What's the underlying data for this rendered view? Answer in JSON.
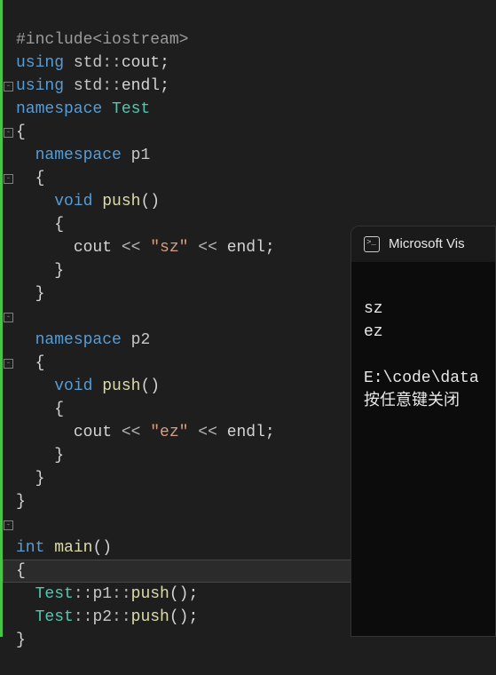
{
  "code": {
    "line1_include": "#include",
    "line1_header": "<iostream>",
    "line2_using": "using",
    "line2_std": "std",
    "line2_cout": "cout",
    "line3_using": "using",
    "line3_std": "std",
    "line3_endl": "endl",
    "line4_namespace": "namespace",
    "line4_Test": "Test",
    "line6_namespace": "namespace",
    "line6_p1": "p1",
    "line8_void": "void",
    "line8_push": "push",
    "line10_cout": "cout",
    "line10_sz": "\"sz\"",
    "line10_endl": "endl",
    "line14_namespace": "namespace",
    "line14_p2": "p2",
    "line16_void": "void",
    "line16_push": "push",
    "line18_cout": "cout",
    "line18_ez": "\"ez\"",
    "line18_endl": "endl",
    "line22_int": "int",
    "line22_main": "main",
    "line24_Test": "Test",
    "line24_p1": "p1",
    "line24_push": "push",
    "line25_Test": "Test",
    "line25_p2": "p2",
    "line25_push": "push",
    "brace_open": "{",
    "brace_close": "}",
    "paren_pair": "()",
    "scope": "::",
    "semi": ";",
    "shift": " << "
  },
  "terminal": {
    "title": "Microsoft Vis",
    "out1": "sz",
    "out2": "ez",
    "path": "E:\\code\\data",
    "prompt": "按任意键关闭"
  }
}
